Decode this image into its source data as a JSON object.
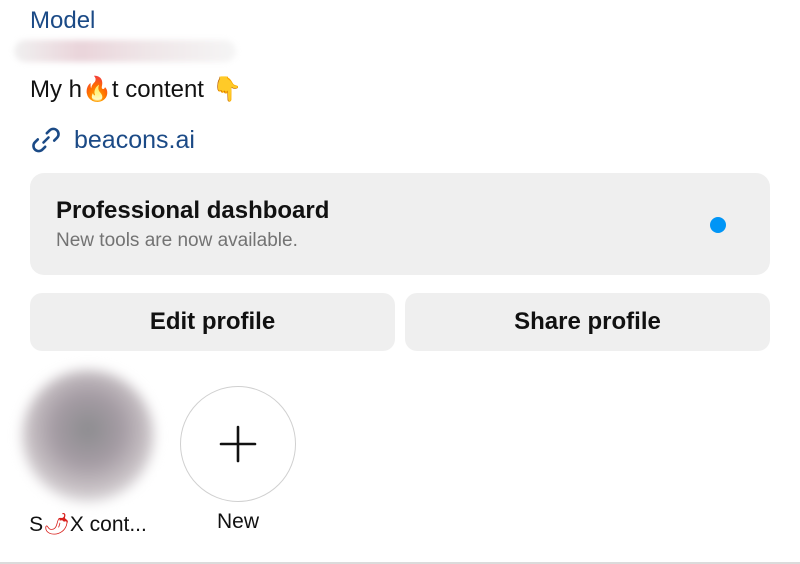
{
  "profile": {
    "category": "Model",
    "bio_parts": [
      "My h",
      "🔥",
      "t content",
      "👇"
    ],
    "link_text": "beacons.ai"
  },
  "dashboard": {
    "title": "Professional dashboard",
    "subtitle": "New tools are now available."
  },
  "buttons": {
    "edit": "Edit profile",
    "share": "Share profile"
  },
  "highlights": {
    "items": [
      {
        "label_parts": [
          "S",
          "🌶",
          "X cont..."
        ]
      },
      {
        "label": "New"
      }
    ]
  },
  "colors": {
    "link": "#1b4a86",
    "dot": "#0095f6",
    "card_bg": "#efefef"
  },
  "icons": [
    "link-icon",
    "notification-dot",
    "plus-icon"
  ]
}
